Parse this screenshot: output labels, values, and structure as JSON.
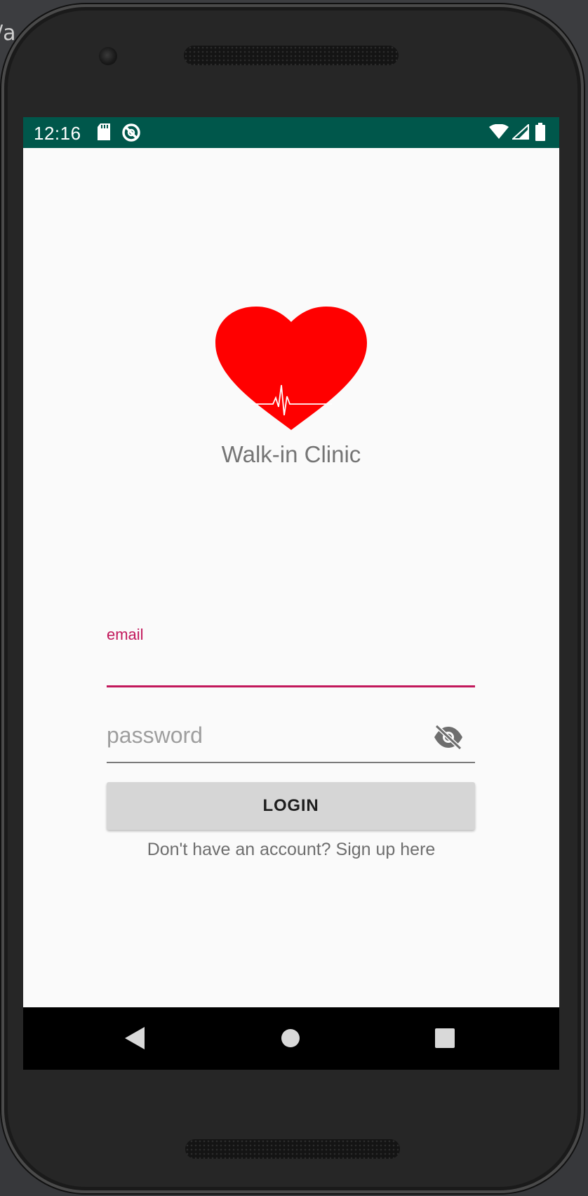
{
  "desktop": {
    "edge_text": "/a"
  },
  "status_bar": {
    "time": "12:16",
    "icons": [
      "sd-card-icon",
      "do-not-disturb-icon",
      "wifi-icon",
      "signal-icon",
      "battery-icon"
    ],
    "color": "#00574b"
  },
  "app": {
    "logo_icon": "heart-ecg-icon",
    "title": "Walk-in Clinic",
    "logo_color": "#ff0000"
  },
  "form": {
    "email": {
      "label": "email",
      "value": "",
      "accent": "#c2185b"
    },
    "password": {
      "placeholder": "password",
      "value": "",
      "toggle_icon": "eye-off-icon"
    },
    "login_label": "LOGIN",
    "signup_text": "Don't have an account? Sign up here"
  },
  "nav_bar": {
    "buttons": [
      "back-icon",
      "home-icon",
      "recents-icon"
    ]
  }
}
